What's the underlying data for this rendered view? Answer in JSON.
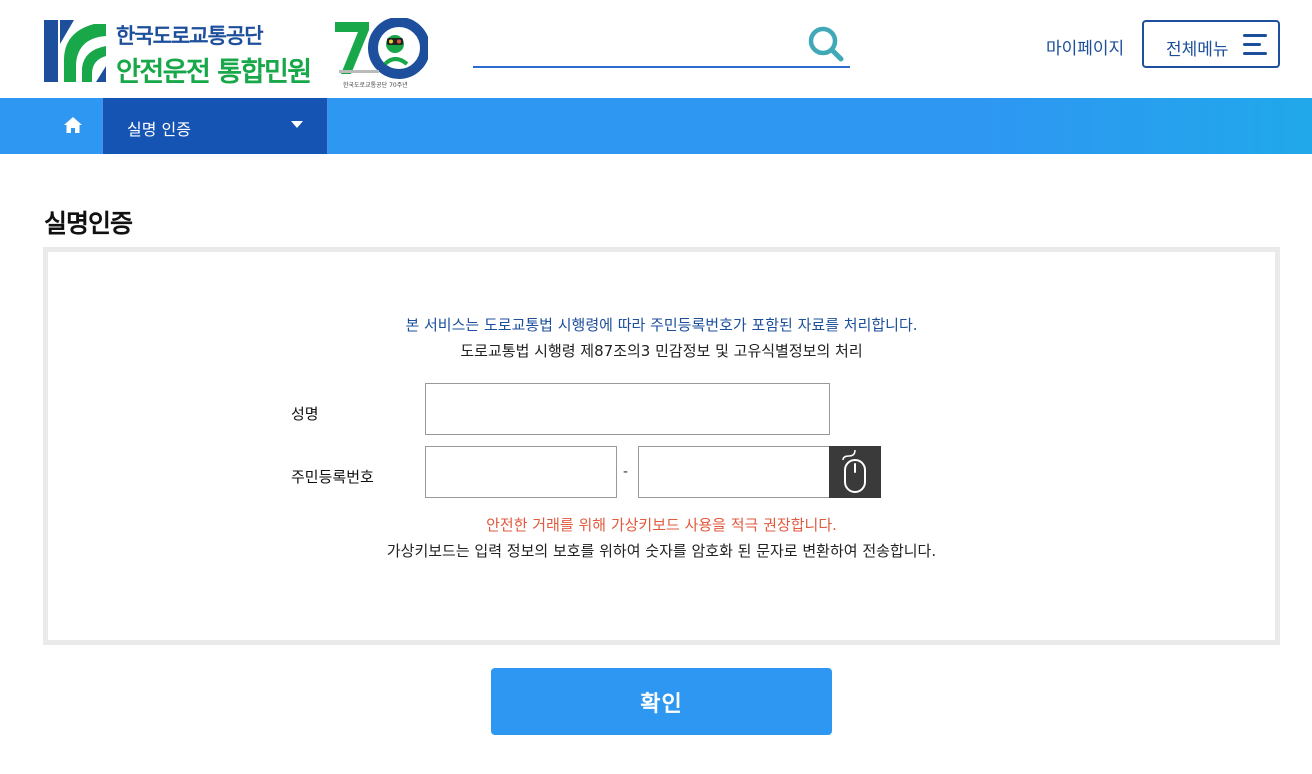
{
  "header": {
    "org_name": "한국도로교통공단",
    "site_name": "안전운전 통합민원",
    "anniversary_caption": "한국도로교통공단 70주년",
    "search": {
      "placeholder": "",
      "value": ""
    },
    "mypage_label": "마이페이지",
    "allmenu_label": "전체메뉴"
  },
  "nav": {
    "current_label": "실명 인증"
  },
  "page": {
    "title": "실명인증"
  },
  "form": {
    "notice_blue": "본 서비스는 도로교통법 시행령에 따라 주민등록번호가 포함된 자료를 처리합니다.",
    "notice_dark": "도로교통법 시행령 제87조의3 민감정보 및 고유식별정보의 처리",
    "name_label": "성명",
    "name_value": "",
    "rrn_label": "주민등록번호",
    "rrn_front_value": "",
    "rrn_dash": "-",
    "rrn_back_value": "",
    "warn_red": "안전한 거래를 위해 가상키보드 사용을 적극 권장합니다.",
    "warn_dark": "가상키보드는 입력 정보의 보호를 위하여 숫자를 암호화 된 문자로 변환하여 전송합니다."
  },
  "actions": {
    "confirm_label": "확인"
  },
  "colors": {
    "brand_blue": "#1d4f9c",
    "nav_blue": "#2e97f2",
    "nav_dark": "#1654b4",
    "brand_green": "#18a84a",
    "warn_red": "#e05a3e"
  },
  "icons": [
    "logo-mark-icon",
    "anniversary-70-icon",
    "search-icon",
    "hamburger-icon",
    "home-icon",
    "caret-down-icon",
    "mouse-icon"
  ]
}
